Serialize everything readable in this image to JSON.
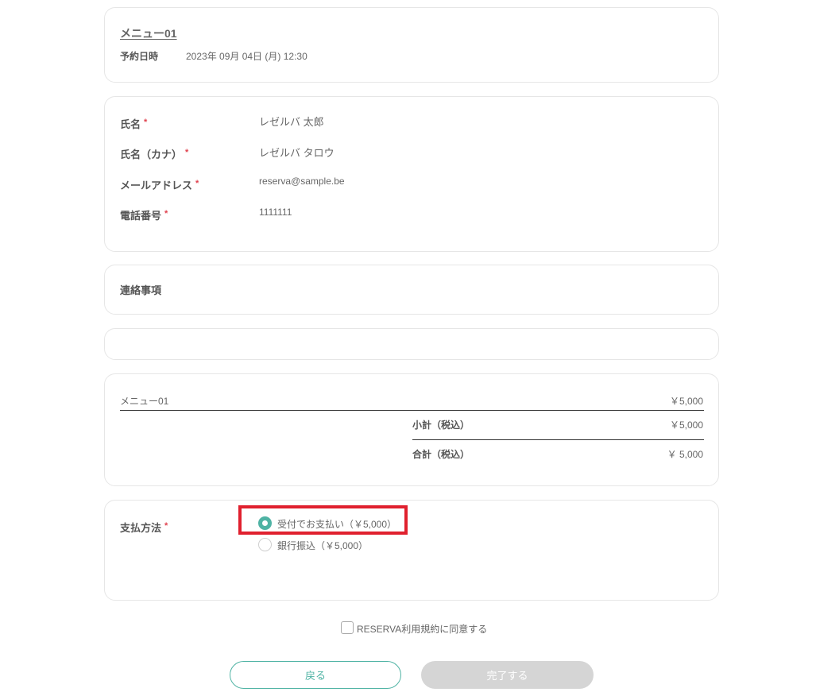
{
  "reservation": {
    "menu_name": "メニュー01",
    "datetime_label": "予約日時",
    "datetime_value": "2023年 09月 04日 (月) 12:30"
  },
  "customer": {
    "fields": [
      {
        "label": "氏名",
        "required_mark": "*",
        "value": "レゼルバ 太郎"
      },
      {
        "label": "氏名（カナ）",
        "required_mark": "*",
        "value": "レゼルバ タロウ"
      },
      {
        "label": "メールアドレス",
        "required_mark": "*",
        "value": "reserva@sample.be"
      },
      {
        "label": "電話番号",
        "required_mark": "*",
        "value": "1111111"
      }
    ]
  },
  "notes": {
    "label": "連絡事項"
  },
  "pricing": {
    "item_name": "メニュー01",
    "item_price": "￥5,000",
    "subtotal_label": "小計（税込）",
    "subtotal_value": "￥5,000",
    "total_label": "合計（税込）",
    "total_value": "￥ 5,000"
  },
  "payment": {
    "label": "支払方法",
    "required_mark": "*",
    "options": [
      {
        "label": "受付でお支払い（￥5,000）",
        "selected": true
      },
      {
        "label": "銀行振込（￥5,000）",
        "selected": false
      }
    ]
  },
  "terms": {
    "label": "RESERVA利用規約に同意する",
    "checked": false
  },
  "buttons": {
    "back_label": "戻る",
    "complete_label": "完了する"
  },
  "colors": {
    "accent": "#4fb3a4",
    "required": "#e0424e",
    "highlight": "#e0202e",
    "disabled": "#d5d5d5"
  }
}
